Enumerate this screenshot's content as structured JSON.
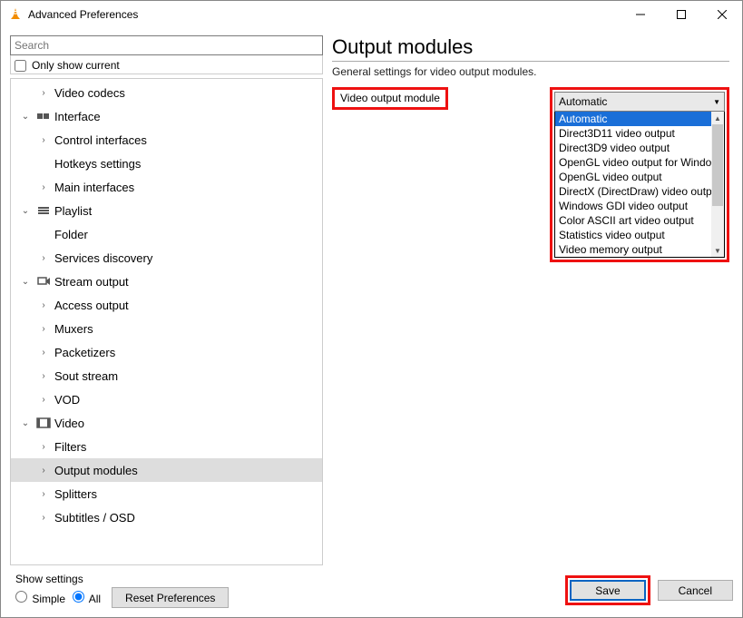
{
  "window": {
    "title": "Advanced Preferences"
  },
  "search": {
    "placeholder": "Search"
  },
  "only_current_label": "Only show current",
  "tree": {
    "items": [
      {
        "label": "Video codecs",
        "level": 1,
        "exp": ">",
        "icon": ""
      },
      {
        "label": "Interface",
        "level": 0,
        "exp": "v",
        "icon": "interface"
      },
      {
        "label": "Control interfaces",
        "level": 1,
        "exp": ">",
        "icon": ""
      },
      {
        "label": "Hotkeys settings",
        "level": 1,
        "exp": "",
        "icon": ""
      },
      {
        "label": "Main interfaces",
        "level": 1,
        "exp": ">",
        "icon": ""
      },
      {
        "label": "Playlist",
        "level": 0,
        "exp": "v",
        "icon": "playlist"
      },
      {
        "label": "Folder",
        "level": 1,
        "exp": "",
        "icon": ""
      },
      {
        "label": "Services discovery",
        "level": 1,
        "exp": ">",
        "icon": ""
      },
      {
        "label": "Stream output",
        "level": 0,
        "exp": "v",
        "icon": "stream"
      },
      {
        "label": "Access output",
        "level": 1,
        "exp": ">",
        "icon": ""
      },
      {
        "label": "Muxers",
        "level": 1,
        "exp": ">",
        "icon": ""
      },
      {
        "label": "Packetizers",
        "level": 1,
        "exp": ">",
        "icon": ""
      },
      {
        "label": "Sout stream",
        "level": 1,
        "exp": ">",
        "icon": ""
      },
      {
        "label": "VOD",
        "level": 1,
        "exp": ">",
        "icon": ""
      },
      {
        "label": "Video",
        "level": 0,
        "exp": "v",
        "icon": "video"
      },
      {
        "label": "Filters",
        "level": 1,
        "exp": ">",
        "icon": ""
      },
      {
        "label": "Output modules",
        "level": 1,
        "exp": ">",
        "icon": "",
        "selected": true
      },
      {
        "label": "Splitters",
        "level": 1,
        "exp": ">",
        "icon": ""
      },
      {
        "label": "Subtitles / OSD",
        "level": 1,
        "exp": ">",
        "icon": ""
      }
    ]
  },
  "panel": {
    "heading": "Output modules",
    "desc": "General settings for video output modules.",
    "label": "Video output module",
    "selected": "Automatic",
    "options": [
      "Automatic",
      "Direct3D11 video output",
      "Direct3D9 video output",
      "OpenGL video output for Windows",
      "OpenGL video output",
      "DirectX (DirectDraw) video output",
      "Windows GDI video output",
      "Color ASCII art video output",
      "Statistics video output",
      "Video memory output"
    ]
  },
  "footer": {
    "show_settings_label": "Show settings",
    "simple_label": "Simple",
    "all_label": "All",
    "reset_label": "Reset Preferences",
    "save_label": "Save",
    "cancel_label": "Cancel"
  }
}
